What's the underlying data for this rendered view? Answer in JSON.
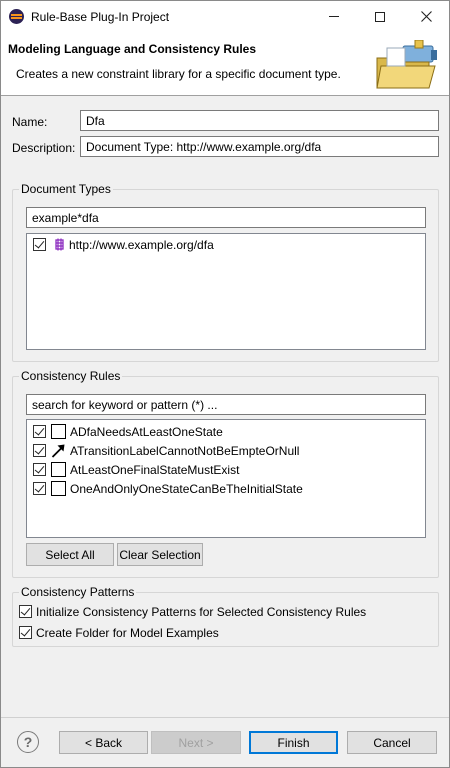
{
  "window": {
    "title": "Rule-Base Plug-In Project"
  },
  "banner": {
    "title": "Modeling Language and Consistency Rules",
    "description": "Creates a new constraint library for a specific document type."
  },
  "fields": {
    "name_label": "Name:",
    "name_value": "Dfa",
    "description_label": "Description:",
    "description_value": "Document Type: http://www.example.org/dfa"
  },
  "document_types": {
    "legend": "Document Types",
    "filter_value": "example*dfa",
    "items": [
      {
        "label": "http://www.example.org/dfa",
        "checked": true,
        "icon": "package-icon"
      }
    ]
  },
  "consistency_rules": {
    "legend": "Consistency Rules",
    "search_placeholder": "search for keyword or pattern (*) ...",
    "items": [
      {
        "label": "ADfaNeedsAtLeastOneState",
        "checked": true,
        "icon": "square-icon"
      },
      {
        "label": "ATransitionLabelCannotNotBeEmpteOrNull",
        "checked": true,
        "icon": "arrow-icon"
      },
      {
        "label": "AtLeastOneFinalStateMustExist",
        "checked": true,
        "icon": "square-icon"
      },
      {
        "label": "OneAndOnlyOneStateCanBeTheInitialState",
        "checked": true,
        "icon": "square-icon"
      }
    ],
    "select_all_label": "Select All",
    "clear_selection_label": "Clear Selection"
  },
  "consistency_patterns": {
    "legend": "Consistency Patterns",
    "options": [
      {
        "label": "Initialize Consistency Patterns for Selected Consistency Rules",
        "checked": true
      },
      {
        "label": "Create Folder for Model Examples",
        "checked": true
      }
    ]
  },
  "footer": {
    "help_symbol": "?",
    "back_label": "< Back",
    "next_label": "Next >",
    "finish_label": "Finish",
    "cancel_label": "Cancel"
  },
  "colors": {
    "accent": "#0078d7",
    "package_icon": "#8b2bbf"
  }
}
